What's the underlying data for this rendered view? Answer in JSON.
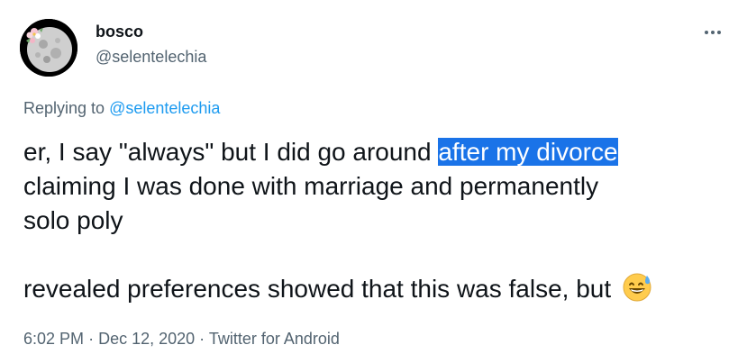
{
  "author": {
    "display_name": "bosco",
    "handle": "@selentelechia",
    "avatar_icon": "moon-with-flowers-avatar"
  },
  "reply": {
    "prefix": "Replying to",
    "mention": "@selentelechia"
  },
  "tweet": {
    "text_before_highlight": "er, I say \"always\" but I did go around ",
    "highlighted_text": "after my divorce",
    "text_after_highlight": "\nclaiming I was done with marriage and permanently\nsolo poly\n\nrevealed preferences showed that this was false, but ",
    "trailing_emoji": "grinning-face-with-sweat-icon"
  },
  "meta": {
    "time": "6:02 PM",
    "date": "Dec 12, 2020",
    "source": "Twitter for Android",
    "separator": "·"
  },
  "colors": {
    "text_primary": "#0f1419",
    "text_secondary": "#536471",
    "link": "#1d9bf0",
    "selection_highlight": "#1a73e8"
  }
}
